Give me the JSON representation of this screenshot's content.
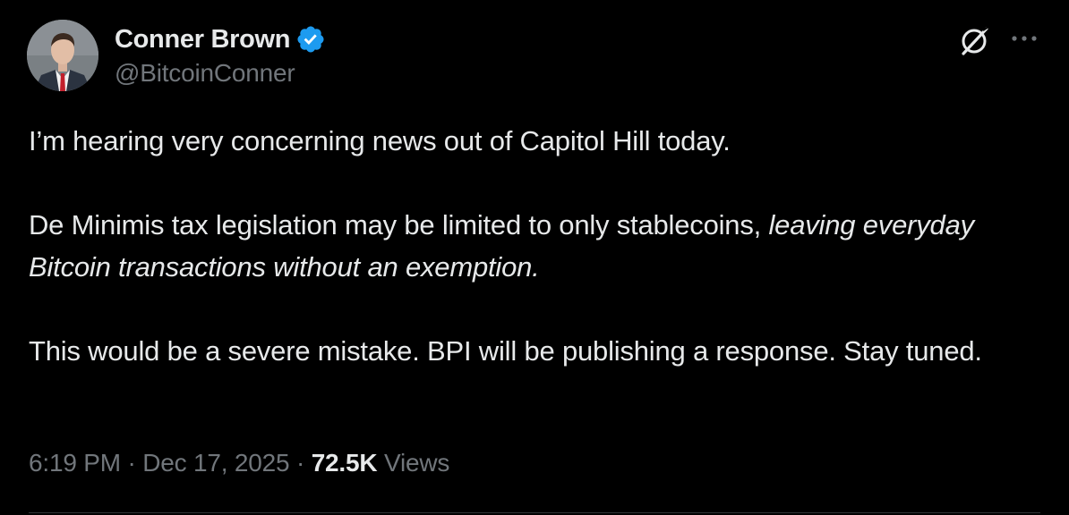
{
  "author": {
    "name": "Conner Brown",
    "handle": "@BitcoinConner",
    "verified": true,
    "verified_color": "#1d9bf0"
  },
  "tweet": {
    "paragraph_1": "I’m hearing very concerning news out of Capitol Hill today.",
    "paragraph_2_regular": "De Minimis tax legislation may be limited to only stablecoins, ",
    "paragraph_2_italic": "leaving everyday Bitcoin transactions without an exemption.",
    "paragraph_3": "This would be a severe mistake. BPI will be publishing a response. Stay tuned."
  },
  "meta": {
    "time": "6:19 PM",
    "separator": "·",
    "date": "Dec 17, 2025",
    "views_count": "72.5K",
    "views_label": "Views"
  },
  "icons": {
    "grok": "grok-icon",
    "more": "more-icon",
    "verified": "verified-badge-icon"
  },
  "colors": {
    "background": "#000000",
    "text_primary": "#e7e9ea",
    "text_secondary": "#71767b",
    "accent": "#1d9bf0"
  }
}
